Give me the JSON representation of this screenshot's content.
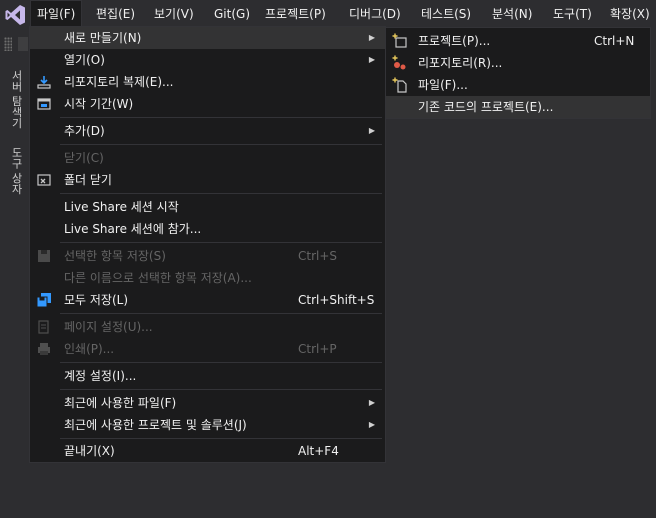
{
  "menubar": {
    "items": [
      "파일(F)",
      "편집(E)",
      "보기(V)",
      "Git(G)",
      "프로젝트(P)",
      "디버그(D)",
      "테스트(S)",
      "분석(N)",
      "도구(T)",
      "확장(X)"
    ]
  },
  "side_tabs": [
    "서버 탐색기",
    "도구 상자"
  ],
  "file_menu": {
    "new": {
      "label": "새로 만들기(N)"
    },
    "open": {
      "label": "열기(O)"
    },
    "clone": {
      "label": "리포지토리 복제(E)..."
    },
    "start_window": {
      "label": "시작 기간(W)"
    },
    "add": {
      "label": "추가(D)"
    },
    "close": {
      "label": "닫기(C)"
    },
    "close_folder": {
      "label": "폴더 닫기"
    },
    "live_share_start": {
      "label": "Live Share 세션 시작"
    },
    "live_share_join": {
      "label": "Live Share 세션에 참가..."
    },
    "save_selected": {
      "label": "선택한 항목 저장(S)",
      "shortcut": "Ctrl+S"
    },
    "save_as": {
      "label": "다른 이름으로 선택한 항목 저장(A)..."
    },
    "save_all": {
      "label": "모두 저장(L)",
      "shortcut": "Ctrl+Shift+S"
    },
    "page_setup": {
      "label": "페이지 설정(U)..."
    },
    "print": {
      "label": "인쇄(P)...",
      "shortcut": "Ctrl+P"
    },
    "account_settings": {
      "label": "계정 설정(I)..."
    },
    "recent_files": {
      "label": "최근에 사용한 파일(F)"
    },
    "recent_projects": {
      "label": "최근에 사용한 프로젝트 및 솔루션(J)"
    },
    "exit": {
      "label": "끝내기(X)",
      "shortcut": "Alt+F4"
    }
  },
  "new_submenu": {
    "project": {
      "label": "프로젝트(P)...",
      "shortcut": "Ctrl+N"
    },
    "repository": {
      "label": "리포지토리(R)..."
    },
    "file": {
      "label": "파일(F)..."
    },
    "existing_code": {
      "label": "기존 코드의 프로젝트(E)..."
    }
  },
  "colors": {
    "accent": "#3399ff",
    "vs_purple": "#8661c5",
    "menu_bg": "#1b1b1c",
    "disabled": "#656565"
  }
}
